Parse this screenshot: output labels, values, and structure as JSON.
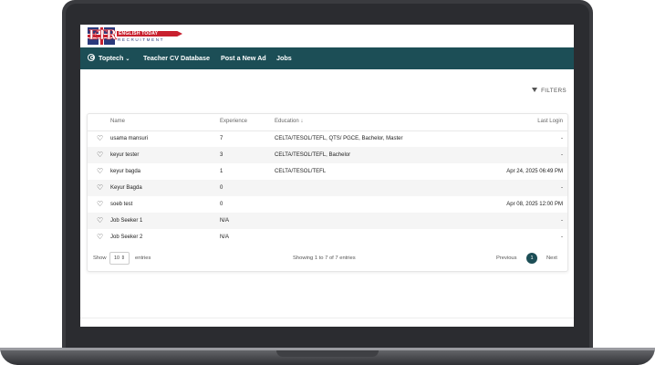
{
  "logo": {
    "mark": "ETR",
    "name": "ENGLISH TODAY",
    "tagline": "RECRUITMENT"
  },
  "nav": {
    "user_label": "Toptech",
    "items": [
      "Teacher CV Database",
      "Post a New Ad",
      "Jobs"
    ]
  },
  "filters_label": "FILTERS",
  "table": {
    "columns": [
      "Name",
      "Experience",
      "Education ↓",
      "Last Login"
    ],
    "rows": [
      {
        "name": "usama mansuri",
        "experience": "7",
        "education": "CELTA/TESOL/TEFL, QTS/ PGCE, Bachelor, Master",
        "last_login": "-"
      },
      {
        "name": "keyur tester",
        "experience": "3",
        "education": "CELTA/TESOL/TEFL, Bachelor",
        "last_login": "-"
      },
      {
        "name": "keyur bagda",
        "experience": "1",
        "education": "CELTA/TESOL/TEFL",
        "last_login": "Apr 24, 2025 06:49 PM"
      },
      {
        "name": "Keyur Bagda",
        "experience": "0",
        "education": "",
        "last_login": "-"
      },
      {
        "name": "soeb test",
        "experience": "0",
        "education": "",
        "last_login": "Apr 08, 2025 12:00 PM"
      },
      {
        "name": "Job Seeker 1",
        "experience": "N/A",
        "education": "",
        "last_login": "-"
      },
      {
        "name": "Job Seeker 2",
        "experience": "N/A",
        "education": "",
        "last_login": "-"
      }
    ]
  },
  "footer": {
    "show_label": "Show",
    "page_size": "10",
    "page_size_arrow": "⇕",
    "entries_label": "entries",
    "info": "Showing 1 to 7 of 7 entries",
    "prev": "Previous",
    "current_page": "1",
    "next": "Next"
  },
  "colors": {
    "brand": "#1c4e56",
    "accent_red": "#c8202f",
    "accent_blue": "#2a3a7c"
  },
  "icons": {
    "user": "user-circle-icon",
    "filter": "funnel-icon",
    "favorite": "heart-outline-icon",
    "sort": "arrow-down-icon"
  }
}
